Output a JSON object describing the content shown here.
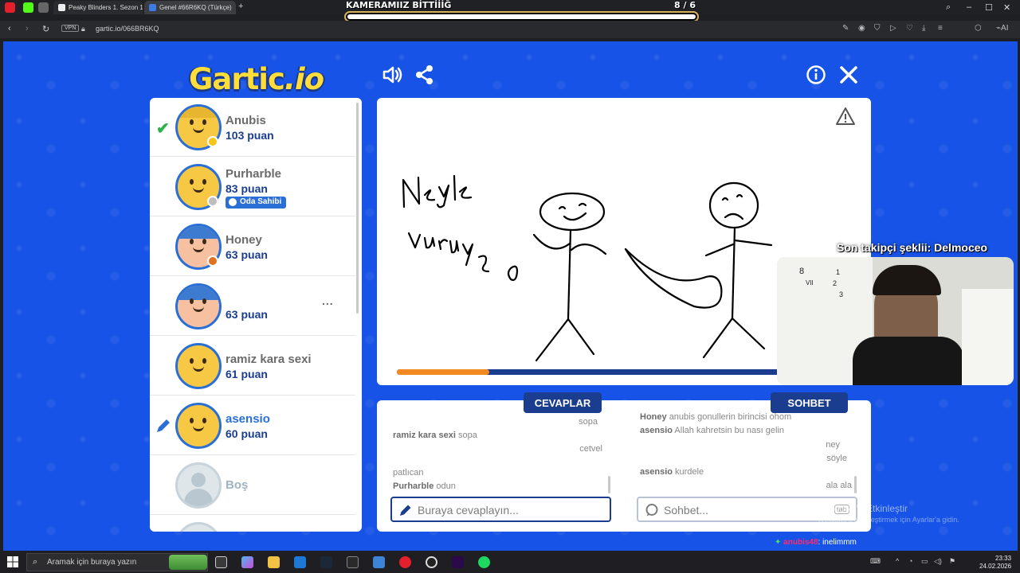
{
  "browser": {
    "tabs": [
      {
        "title": "Peaky Blinders 1. Sezon 1.",
        "active": false
      },
      {
        "title": "Genel #66R6KQ (Türkçe)",
        "active": true
      }
    ],
    "new_tab_icon": "plus-icon",
    "url": "gartic.io/066BR6KQ",
    "vpn_label": "VPN"
  },
  "stream": {
    "title": "KAMERAMIIZ BİTTİİİĞ",
    "count": "8 / 6",
    "follower_text": "Son takipçi şeklii: Delmoceo",
    "chat_user": "anubis48",
    "chat_message": ": inelimmm"
  },
  "game": {
    "logo_main": "Gartic",
    "logo_suffix": ".io",
    "players": [
      {
        "name": "Anubis",
        "score": "103 puan",
        "guessed": true,
        "status_color": "#f5c518",
        "hair": "#e8b530"
      },
      {
        "name": "Purharble",
        "score": "83 puan",
        "owner_badge": "Oda Sahibi",
        "status_color": "#bdbdbd"
      },
      {
        "name": "Honey",
        "score": "63 puan",
        "status_color": "#e0731f",
        "hair": "#3c7bd0"
      },
      {
        "name": "",
        "score": "63 puan",
        "menu": "..."
      },
      {
        "name": "ramiz kara sexi",
        "score": "61 puan"
      },
      {
        "name": "asensio",
        "score": "60 puan",
        "drawing": true
      },
      {
        "name": "Boş",
        "empty": true
      }
    ],
    "timer_progress": 0.24,
    "answers_tab": "CEVAPLAR",
    "chat_tab": "SOHBET",
    "answers": [
      {
        "user": "",
        "text": "sopa",
        "align": "right"
      },
      {
        "user": "ramiz kara sexi",
        "text": "sopa",
        "align": "left"
      },
      {
        "user": "",
        "text": "cetvel",
        "align": "right"
      },
      {
        "user": "",
        "text": "patlıcan",
        "align": "left"
      },
      {
        "user": "Purharble",
        "text": "odun",
        "align": "left"
      }
    ],
    "chat": [
      {
        "user": "Honey",
        "text": "anubis gonullerin birincisi ohom",
        "align": "left"
      },
      {
        "user": "asensio",
        "text": "Allah kahretsin bu nası gelin",
        "align": "left"
      },
      {
        "user": "",
        "text": "ney",
        "align": "right"
      },
      {
        "user": "",
        "text": "söyle",
        "align": "right"
      },
      {
        "user": "asensio",
        "text": "kurdele",
        "align": "left"
      },
      {
        "user": "",
        "text": "ala ala",
        "align": "right"
      }
    ],
    "answer_placeholder": "Buraya cevaplayın...",
    "chat_placeholder": "Sohbet...",
    "chat_hint": "tab"
  },
  "windows": {
    "activate_title": "Windows'u Etkinleştir",
    "activate_sub": "Windows'u etkinleştirmek için Ayarlar'a gidin.",
    "search_placeholder": "Aramak için buraya yazın",
    "time": "23:33",
    "date": "24.02.2026"
  },
  "colors": {
    "background_blue": "#1753e6",
    "navy": "#1a3d8f",
    "timer_orange": "#f28a22",
    "check_green": "#2bb34a"
  }
}
